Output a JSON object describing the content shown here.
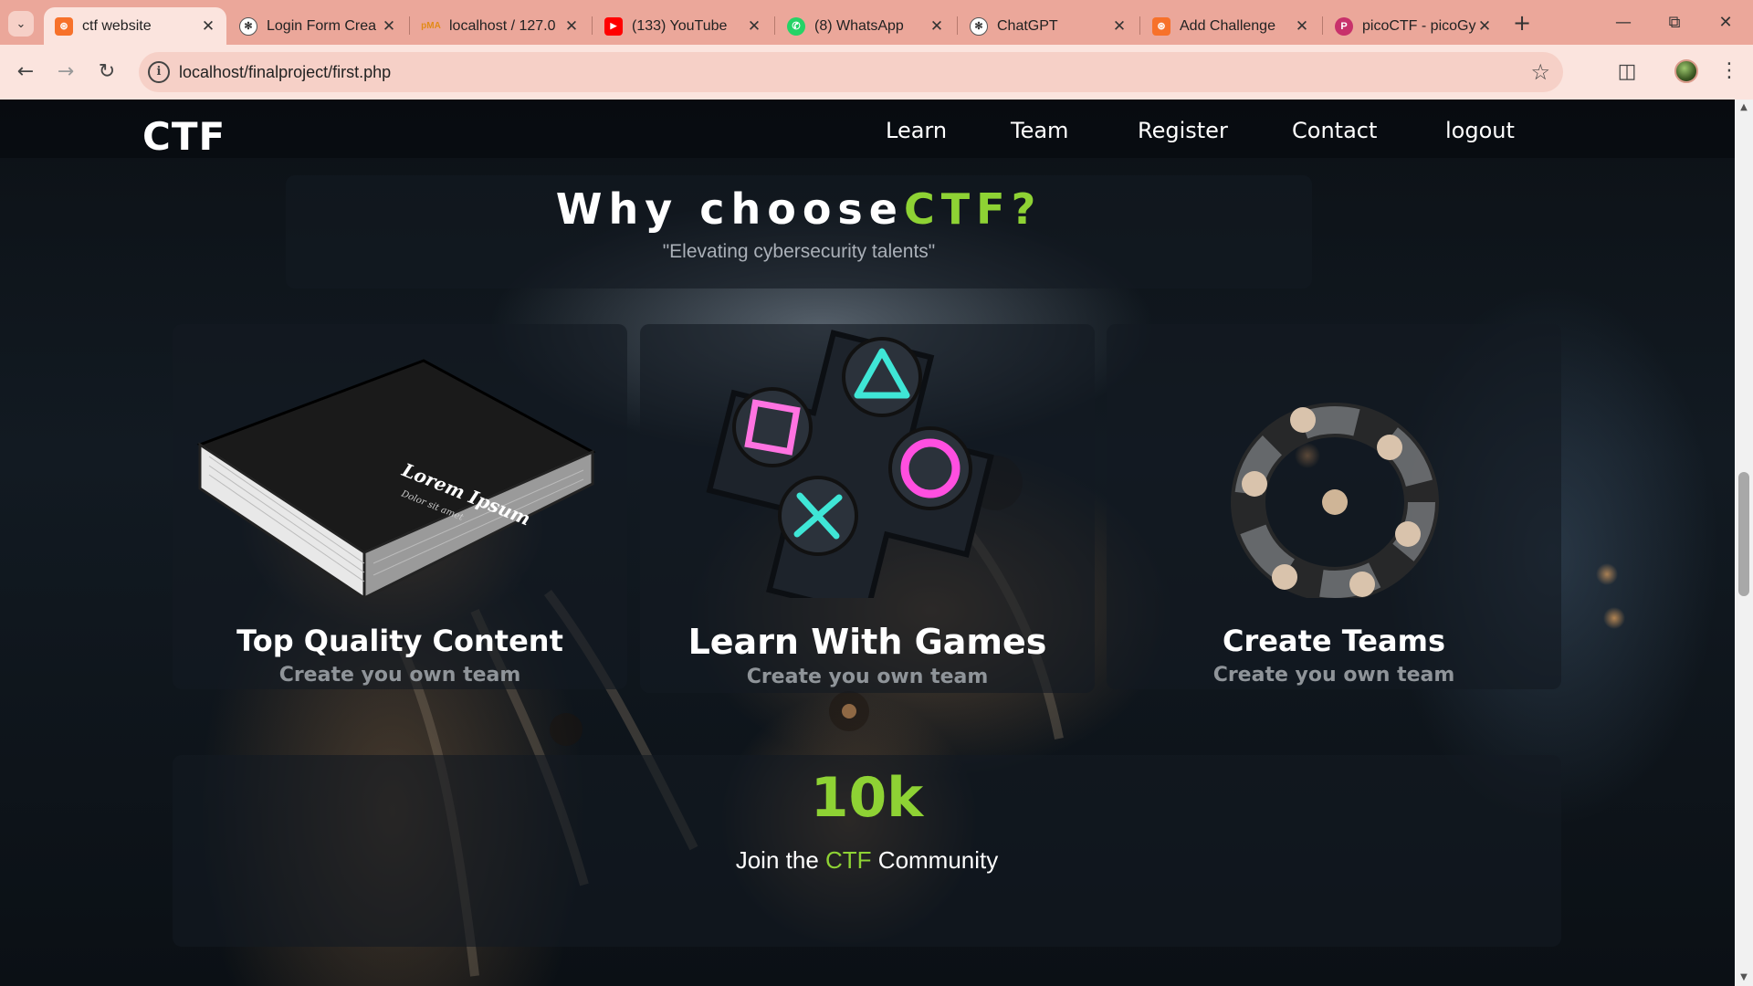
{
  "browser": {
    "tabs": [
      {
        "title": "ctf website",
        "icon": "xampp-icon",
        "active": true
      },
      {
        "title": "Login Form Crea",
        "icon": "chatgpt-icon",
        "active": false
      },
      {
        "title": "localhost / 127.0",
        "icon": "phpmyadmin-icon",
        "active": false
      },
      {
        "title": "(133) YouTube",
        "icon": "youtube-icon",
        "active": false
      },
      {
        "title": "(8) WhatsApp",
        "icon": "whatsapp-icon",
        "active": false
      },
      {
        "title": "ChatGPT",
        "icon": "chatgpt-icon",
        "active": false
      },
      {
        "title": "Add Challenge",
        "icon": "xampp-icon",
        "active": false
      },
      {
        "title": "picoCTF - picoGy",
        "icon": "picoctf-icon",
        "active": false
      }
    ],
    "url": "localhost/finalproject/first.php"
  },
  "site": {
    "logo": "CTF",
    "nav": [
      "Learn",
      "Team",
      "Register",
      "Contact",
      "logout"
    ],
    "hero": {
      "title_main": "Why choose",
      "title_accent": "CTF?",
      "subtitle": "\"Elevating cybersecurity talents\""
    },
    "cards": [
      {
        "title": "Top Quality Content",
        "subtitle": "Create you own team",
        "book_text": "Lorem Ipsum",
        "book_subtext": "Dolor sit amet"
      },
      {
        "title": "Learn With Games",
        "subtitle": "Create you own team"
      },
      {
        "title": "Create Teams",
        "subtitle": "Create you own team"
      }
    ],
    "stats": {
      "number": "10k",
      "text_before": "Join the ",
      "text_accent": "CTF",
      "text_after": " Community"
    }
  },
  "colors": {
    "accent_green": "#8ed234",
    "tab_strip": "#eba79a",
    "toolbar": "#fbe4de"
  }
}
